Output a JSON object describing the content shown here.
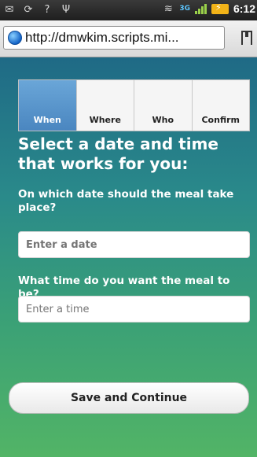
{
  "status_bar": {
    "network": "3G",
    "time": "6:12",
    "icons": [
      "mail-icon",
      "sync-icon",
      "wifi-question-icon",
      "usb-icon",
      "vibrate-icon",
      "signal-icon",
      "battery-charging-icon"
    ]
  },
  "browser": {
    "url": "http://dmwkim.scripts.mi..."
  },
  "tabs": [
    {
      "label": "When",
      "active": true
    },
    {
      "label": "Where",
      "active": false
    },
    {
      "label": "Who",
      "active": false
    },
    {
      "label": "Confirm",
      "active": false
    }
  ],
  "form": {
    "title": "Select a date and time that works for you:",
    "date_question": "On which date should the meal take place?",
    "date_placeholder": "Enter a date",
    "date_value": "",
    "time_question": "What time do you want the meal to be?",
    "time_placeholder": "Enter a time",
    "time_value": "",
    "save_label": "Save and Continue"
  },
  "colors": {
    "active_tab": "#5a96cc",
    "page_top": "#1f6a86",
    "page_bottom": "#52b466"
  }
}
